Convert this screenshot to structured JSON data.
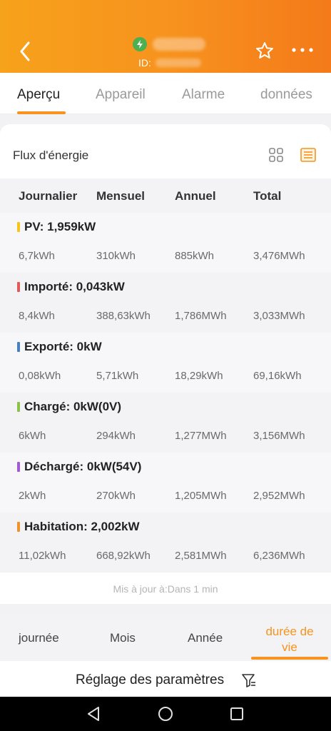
{
  "header": {
    "id_label": "ID:",
    "colors": {
      "bg_start": "#f7a21b",
      "bg_end": "#f47a1a"
    }
  },
  "tabs": [
    {
      "label": "Aperçu",
      "active": true
    },
    {
      "label": "Appareil",
      "active": false
    },
    {
      "label": "Alarme",
      "active": false
    },
    {
      "label": "données",
      "active": false
    }
  ],
  "flux": {
    "title": "Flux d'énergie",
    "columns": [
      "Journalier",
      "Mensuel",
      "Annuel",
      "Total"
    ],
    "rows": [
      {
        "label": "PV: 1,959kW",
        "color": "#f5c518",
        "values": [
          "6,7kWh",
          "310kWh",
          "885kWh",
          "3,476MWh"
        ]
      },
      {
        "label": "Importé: 0,043kW",
        "color": "#e05a5a",
        "values": [
          "8,4kWh",
          "388,63kWh",
          "1,786MWh",
          "3,033MWh"
        ]
      },
      {
        "label": "Exporté: 0kW",
        "color": "#4a7fc1",
        "values": [
          "0,08kWh",
          "5,71kWh",
          "18,29kWh",
          "69,16kWh"
        ]
      },
      {
        "label": "Chargé: 0kW(0V)",
        "color": "#8bc34a",
        "values": [
          "6kWh",
          "294kWh",
          "1,277MWh",
          "3,156MWh"
        ]
      },
      {
        "label": "Déchargé: 0kW(54V)",
        "color": "#a25bd3",
        "values": [
          "2kWh",
          "270kWh",
          "1,205MWh",
          "2,952MWh"
        ]
      },
      {
        "label": "Habitation: 2,002kW",
        "color": "#f0932b",
        "values": [
          "11,02kWh",
          "668,92kWh",
          "2,581MWh",
          "6,236MWh"
        ]
      }
    ],
    "updated": "Mis à jour à:Dans 1 min"
  },
  "period": {
    "tabs": [
      {
        "label": "journée",
        "active": false
      },
      {
        "label": "Mois",
        "active": false
      },
      {
        "label": "Année",
        "active": false
      },
      {
        "label": "durée de vie",
        "line1": "durée de",
        "line2": "vie",
        "active": true
      }
    ]
  },
  "settings": {
    "label": "Réglage des paramètres"
  },
  "accent_color": "#f7931e"
}
